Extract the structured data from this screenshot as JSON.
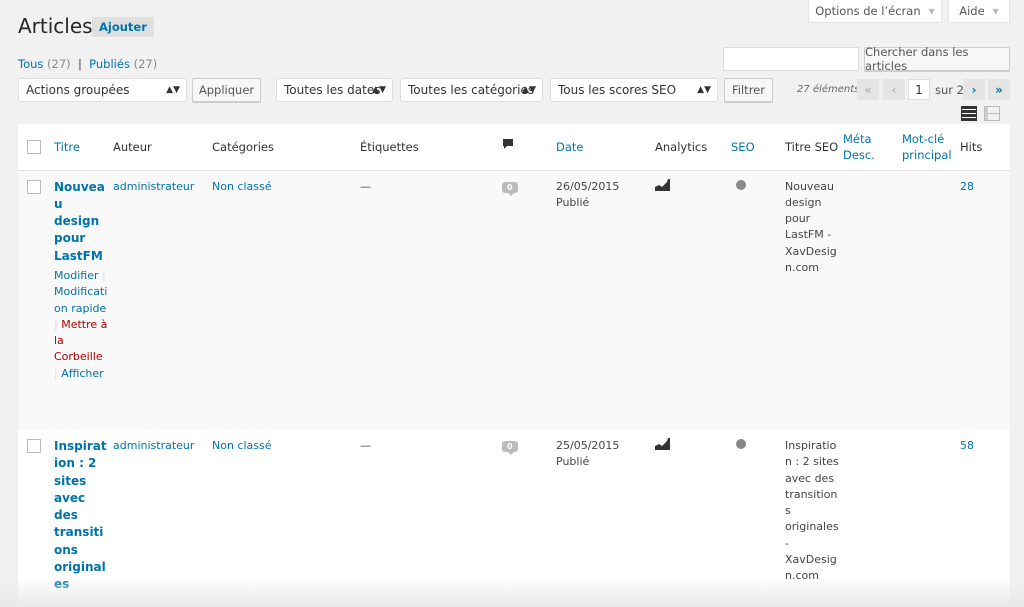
{
  "header": {
    "screen_options": "Options de l’écran",
    "help": "Aide",
    "title": "Articles",
    "add_new": "Ajouter"
  },
  "views": [
    {
      "label": "Tous",
      "count": "(27)"
    },
    {
      "label": "Publiés",
      "count": "(27)"
    }
  ],
  "views_sep": "|",
  "search": {
    "value": "",
    "button": "Chercher dans les articles"
  },
  "filters": {
    "bulk": "Actions groupées",
    "apply": "Appliquer",
    "dates": "Toutes les dates",
    "categories": "Toutes les catégories",
    "seo": "Tous les scores SEO",
    "filter": "Filtrer"
  },
  "pagination": {
    "count": "27 éléments",
    "first": "«",
    "prev": "‹",
    "current": "1",
    "of": "sur 2",
    "next": "›",
    "last": "»"
  },
  "columns": {
    "title": "Titre",
    "author": "Auteur",
    "categories": "Catégories",
    "tags": "Étiquettes",
    "date": "Date",
    "analytics": "Analytics",
    "seo": "SEO",
    "seo_title": "Titre SEO",
    "meta_desc": "Méta Desc.",
    "focus_kw": "Mot-clé principal",
    "hits": "Hits"
  },
  "row_actions": {
    "edit": "Modifier",
    "quick_edit": "Modification rapide",
    "trash": "Mettre à la Corbeille",
    "view": "Afficher",
    "sep": "|"
  },
  "posts": [
    {
      "title": "Nouveau design pour LastFM",
      "author": "administrateur",
      "category": "Non classé",
      "tags": "—",
      "comments": "0",
      "date": "26/05/2015",
      "status": "Publié",
      "seo_title": "Nouveau design pour LastFM - XavDesign.com",
      "meta_desc": "",
      "focus_kw": "",
      "hits": "28"
    },
    {
      "title": "Inspiration : 2 sites avec des transitions originales",
      "author": "administrateur",
      "category": "Non classé",
      "tags": "—",
      "comments": "0",
      "date": "25/05/2015",
      "status": "Publié",
      "seo_title": "Inspiration : 2 sites avec des transitions originales - XavDesign.com",
      "meta_desc": "",
      "focus_kw": "",
      "hits": "58"
    }
  ],
  "colors": {
    "link": "#0073aa",
    "trash": "#a00",
    "background": "#f1f1f1",
    "seo_dot": "#888888"
  }
}
